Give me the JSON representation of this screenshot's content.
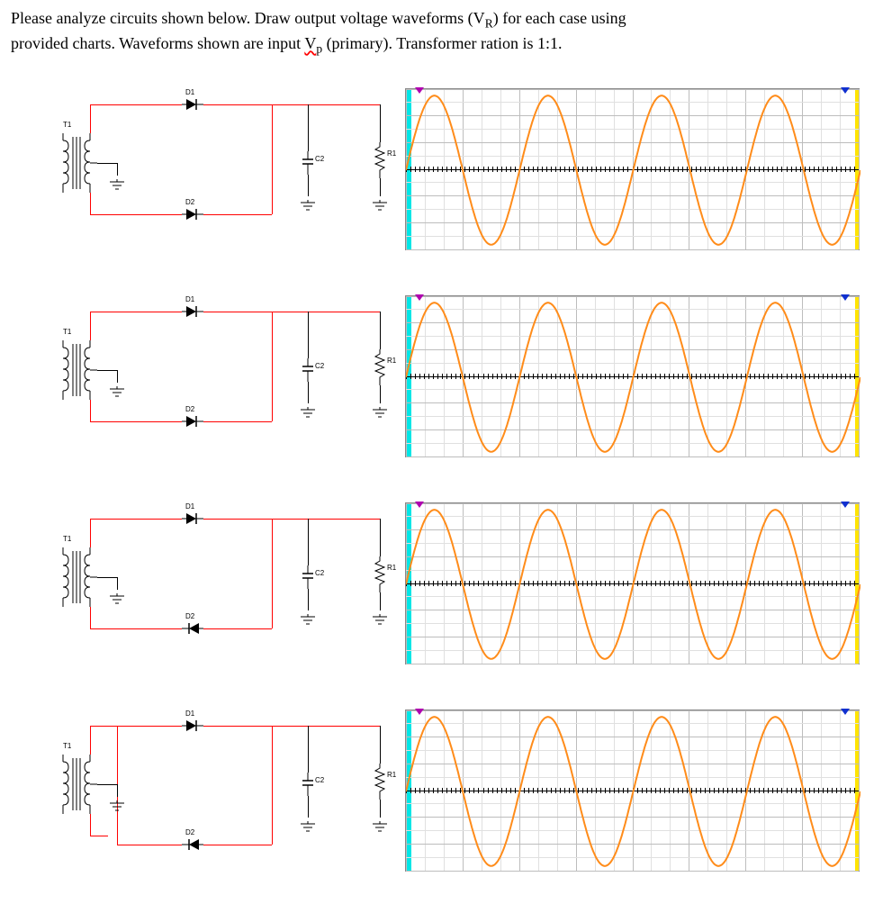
{
  "question": {
    "line1_prefix": "Please analyze circuits shown below. Draw output voltage waveforms (V",
    "line1_sub1": "R",
    "line1_mid": ") for each case using",
    "line2_prefix": "provided charts. Waveforms shown are input ",
    "squiggle": "V",
    "line2_sub": "p",
    "line2_mid": " (primary). Transformer ration is 1:1."
  },
  "labels": {
    "t1": "T1",
    "d1": "D1",
    "d2": "D2",
    "c2": "C2",
    "r1": "R1"
  },
  "chart_data": [
    {
      "type": "line",
      "title": "",
      "xlabel": "",
      "ylabel": "",
      "cycles": 4,
      "amplitude": 1,
      "offset": 0,
      "ylim": [
        -1.2,
        1.2
      ],
      "series": [
        {
          "name": "Vp",
          "kind": "sine"
        }
      ]
    },
    {
      "type": "line",
      "title": "",
      "xlabel": "",
      "ylabel": "",
      "cycles": 4,
      "amplitude": 1,
      "offset": 0,
      "ylim": [
        -1.2,
        1.2
      ],
      "series": [
        {
          "name": "Vp",
          "kind": "sine"
        }
      ]
    },
    {
      "type": "line",
      "title": "",
      "xlabel": "",
      "ylabel": "",
      "cycles": 4,
      "amplitude": 1,
      "offset": 0,
      "ylim": [
        -1.2,
        1.2
      ],
      "series": [
        {
          "name": "Vp",
          "kind": "sine"
        }
      ]
    },
    {
      "type": "line",
      "title": "",
      "xlabel": "",
      "ylabel": "",
      "cycles": 4,
      "amplitude": 1,
      "offset": 0,
      "ylim": [
        -1.2,
        1.2
      ],
      "series": [
        {
          "name": "Vp",
          "kind": "sine"
        }
      ]
    }
  ],
  "circuits": [
    {
      "d1_dir": "right",
      "d2_dir": "right",
      "d2_from": "bottom"
    },
    {
      "d1_dir": "right",
      "d2_dir": "right",
      "d2_from": "bottom"
    },
    {
      "d1_dir": "right",
      "d2_dir": "left",
      "d2_from": "bottom"
    },
    {
      "d1_dir": "right",
      "d2_dir": "left",
      "d2_from": "top_tap"
    }
  ]
}
